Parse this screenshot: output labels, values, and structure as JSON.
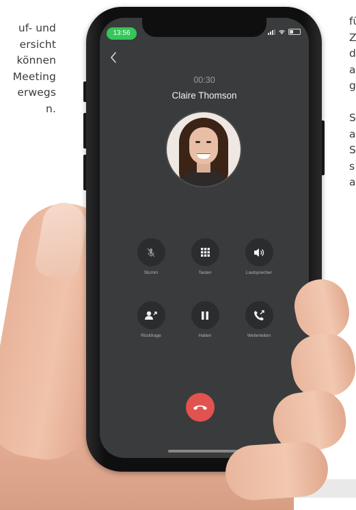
{
  "left_text": [
    "uf- und",
    "ersicht",
    "können",
    "Meeting",
    "erwegs",
    "n."
  ],
  "right_text": [
    "fü",
    "Z",
    "d",
    "a",
    "g",
    "",
    "S",
    "a",
    "S",
    "s",
    "a"
  ],
  "status_bar": {
    "time": "13:56"
  },
  "call": {
    "duration": "00:30",
    "caller_name": "Claire Thomson"
  },
  "controls": {
    "mute": "Stumm",
    "keypad": "Tasten",
    "speaker": "Lautsprecher",
    "consult": "Rückfrage",
    "hold": "Halten",
    "transfer": "Weiterleiten"
  },
  "colors": {
    "screen_bg": "#3a3b3c",
    "button_bg": "#2b2c2d",
    "hangup": "#e0534f",
    "time_pill": "#34c759"
  },
  "icons": {
    "back": "chevron-left-icon",
    "mute": "mic-off-icon",
    "keypad": "keypad-grid-icon",
    "speaker": "speaker-volume-icon",
    "consult": "user-add-arrow-icon",
    "hold": "pause-icon",
    "transfer": "phone-forward-icon",
    "hangup": "phone-hangup-icon"
  }
}
